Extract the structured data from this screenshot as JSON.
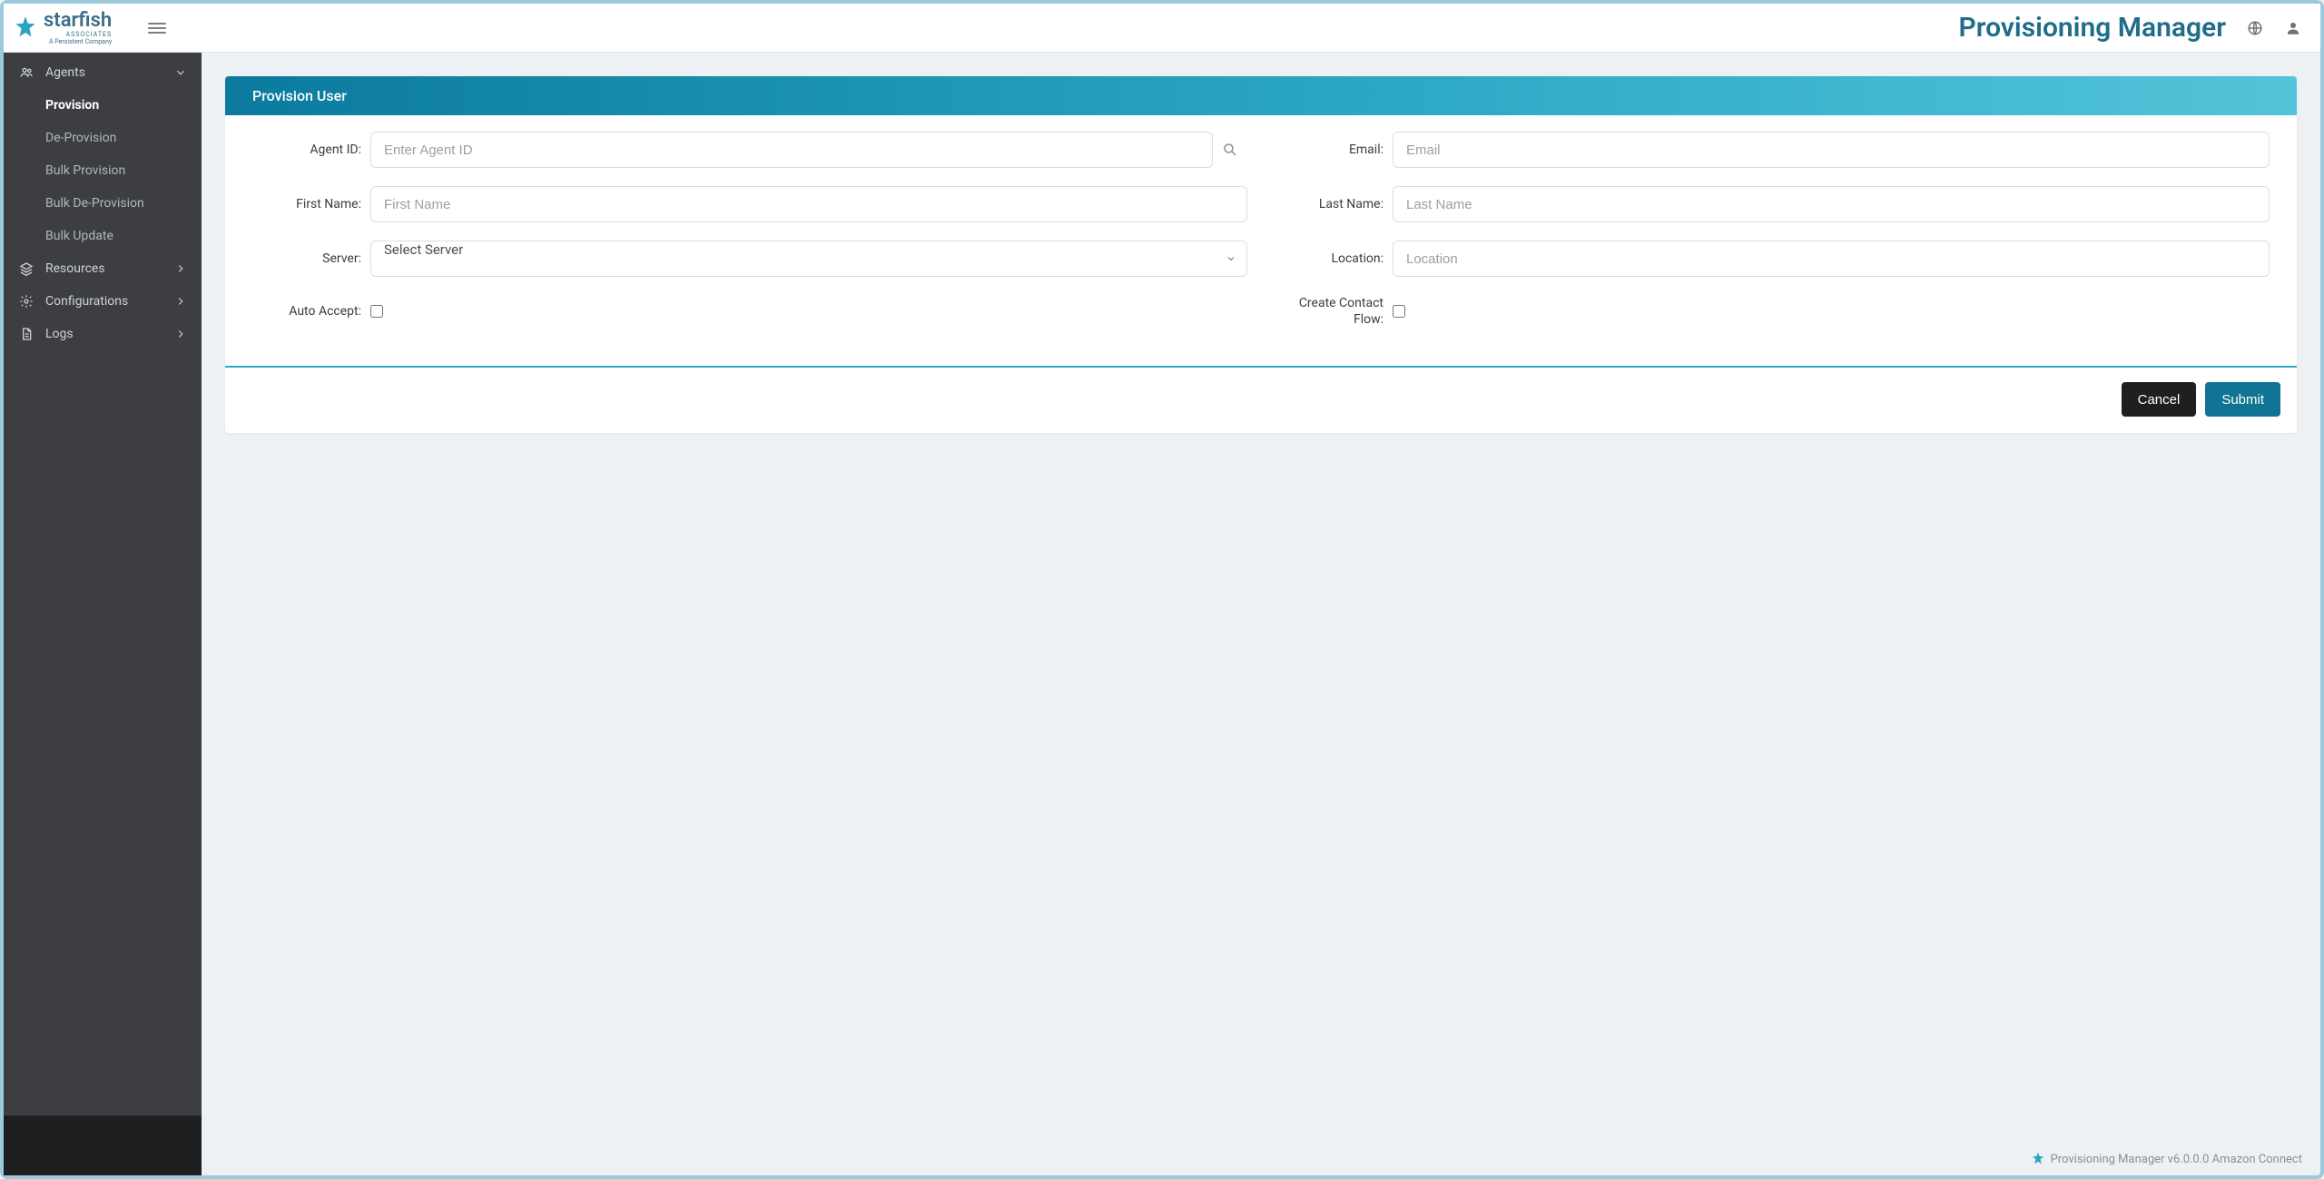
{
  "header": {
    "brand_name": "starfish",
    "brand_sub1": "ASSOCIATES",
    "brand_sub2": "A Persistent Company",
    "app_title": "Provisioning Manager"
  },
  "sidebar": {
    "items": [
      {
        "label": "Agents",
        "expanded": true,
        "icon": "user-group",
        "children": [
          {
            "label": "Provision",
            "active": true
          },
          {
            "label": "De-Provision"
          },
          {
            "label": "Bulk Provision"
          },
          {
            "label": "Bulk De-Provision"
          },
          {
            "label": "Bulk Update"
          }
        ]
      },
      {
        "label": "Resources",
        "icon": "layers"
      },
      {
        "label": "Configurations",
        "icon": "gear"
      },
      {
        "label": "Logs",
        "icon": "file"
      }
    ]
  },
  "card": {
    "title": "Provision User",
    "labels": {
      "agent_id": "Agent ID:",
      "email": "Email:",
      "first_name": "First Name:",
      "last_name": "Last Name:",
      "server": "Server:",
      "location": "Location:",
      "auto_accept": "Auto Accept:",
      "create_contact_flow": "Create Contact Flow:"
    },
    "placeholders": {
      "agent_id": "Enter Agent ID",
      "email": "Email",
      "first_name": "First Name",
      "last_name": "Last Name",
      "location": "Location"
    },
    "server_selected": "Select Server",
    "auto_accept_checked": false,
    "create_contact_flow_checked": false,
    "buttons": {
      "cancel": "Cancel",
      "submit": "Submit"
    }
  },
  "footer": {
    "text": "Provisioning Manager v6.0.0.0 Amazon Connect"
  }
}
